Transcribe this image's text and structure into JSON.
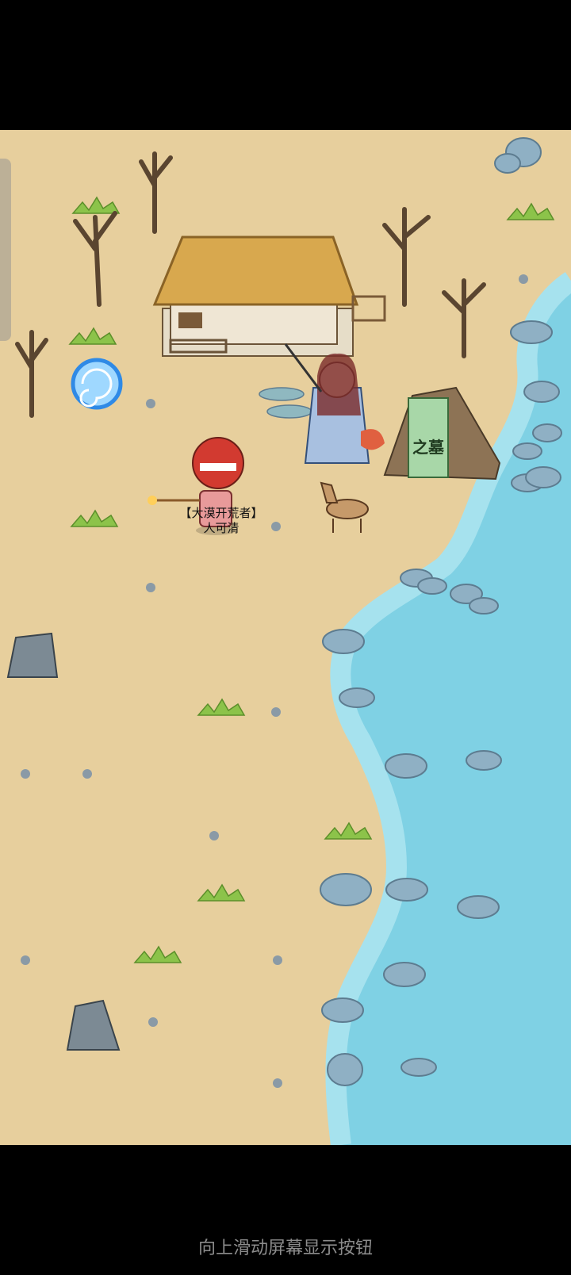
{
  "player": {
    "title": "【大漠开荒者】",
    "name": "人可清"
  },
  "tombstone": {
    "text": "之墓"
  },
  "footer": {
    "hint": "向上滑动屏幕显示按钮"
  },
  "colors": {
    "sand": "#e7cf9d",
    "water": "#7fd1e4",
    "shallow_water": "#a6e2ee",
    "rock": "#8fb0c4",
    "grass": "#8cc34a"
  }
}
